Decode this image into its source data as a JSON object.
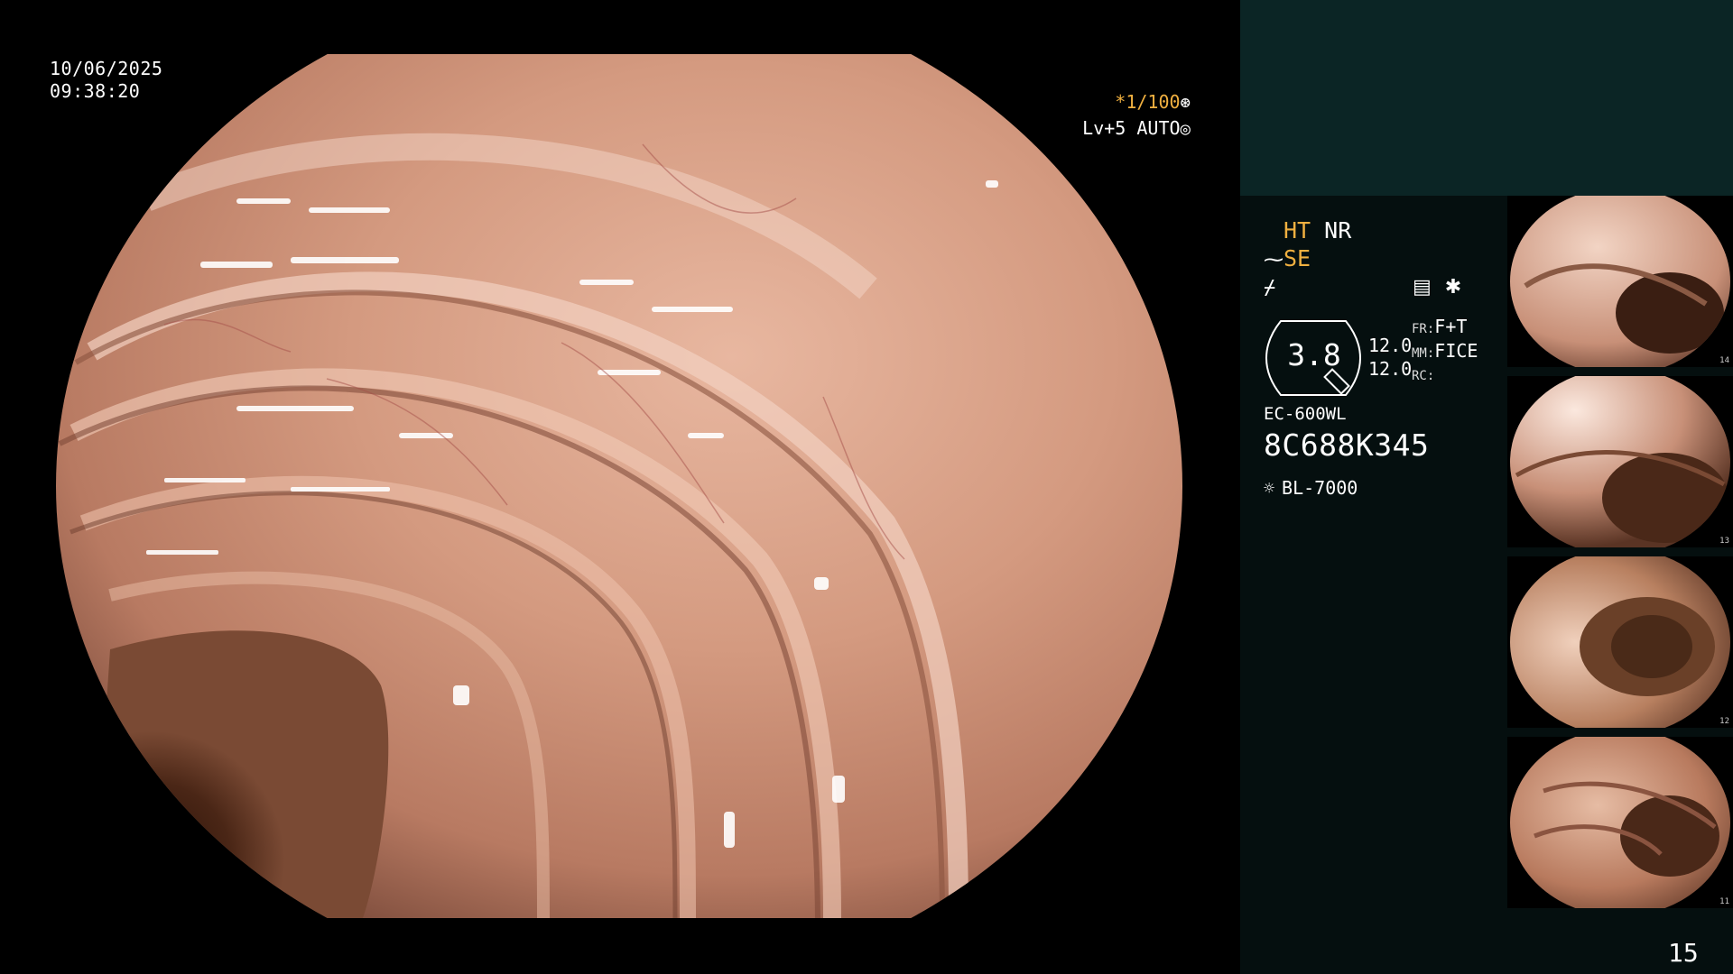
{
  "overlay": {
    "date": "10/06/2025",
    "time": "09:38:20",
    "shutter": "*1/100",
    "level": "Lv+5 AUTO"
  },
  "panel": {
    "mode_ht": "HT",
    "mode_nr": "NR",
    "mode_se": "SE",
    "gauge_value": "3.8",
    "gauge_top": "12.0",
    "gauge_bottom": "12.0",
    "fr_label": "FR:",
    "fr_value": "F+T",
    "mm_label": "MM:",
    "mm_value": "FICE",
    "rc_label": "RC:",
    "scope_model": "EC-600WL",
    "serial": "8C688K345",
    "light_source": "BL-7000",
    "accent_color": "#f0b040",
    "panel_color": "#0b2525"
  },
  "thumbnails": [
    {
      "index": "14"
    },
    {
      "index": "13"
    },
    {
      "index": "12"
    },
    {
      "index": "11"
    }
  ],
  "page_number": "15"
}
